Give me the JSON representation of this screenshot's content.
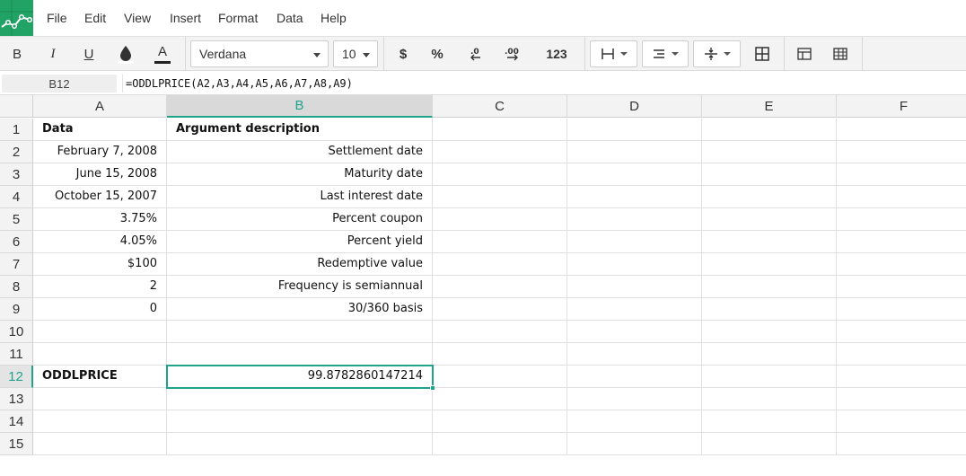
{
  "menu": {
    "file": "File",
    "edit": "Edit",
    "view": "View",
    "insert": "Insert",
    "format": "Format",
    "data": "Data",
    "help": "Help"
  },
  "toolbar": {
    "bold": "B",
    "italic": "I",
    "underline": "U",
    "font_color": "A",
    "font_name": "Verdana",
    "font_size": "10",
    "currency": "$",
    "percent": "%",
    "dec_decrease": ".0",
    "dec_increase": ".00",
    "number_format": "123"
  },
  "formula_bar": {
    "cell_ref": "B12",
    "formula": "=ODDLPRICE(A2,A3,A4,A5,A6,A7,A8,A9)"
  },
  "columns": [
    "A",
    "B",
    "C",
    "D",
    "E",
    "F"
  ],
  "rows": [
    "1",
    "2",
    "3",
    "4",
    "5",
    "6",
    "7",
    "8",
    "9",
    "10",
    "11",
    "12",
    "13",
    "14",
    "15"
  ],
  "cells": {
    "A1": "Data",
    "B1": "Argument description",
    "A2": "February 7, 2008",
    "B2": "Settlement date",
    "A3": "June 15, 2008",
    "B3": "Maturity date",
    "A4": "October 15, 2007",
    "B4": "Last interest date",
    "A5": "3.75%",
    "B5": "Percent coupon",
    "A6": "4.05%",
    "B6": "Percent yield",
    "A7": "$100",
    "B7": "Redemptive value",
    "A8": "2",
    "B8": "Frequency is semiannual",
    "A9": "0",
    "B9": "30/360 basis",
    "A12": "ODDLPRICE",
    "B12": "99.8782860147214"
  },
  "selected_cell": "B12",
  "colors": {
    "accent": "#21a38b",
    "logo": "#21a366"
  }
}
